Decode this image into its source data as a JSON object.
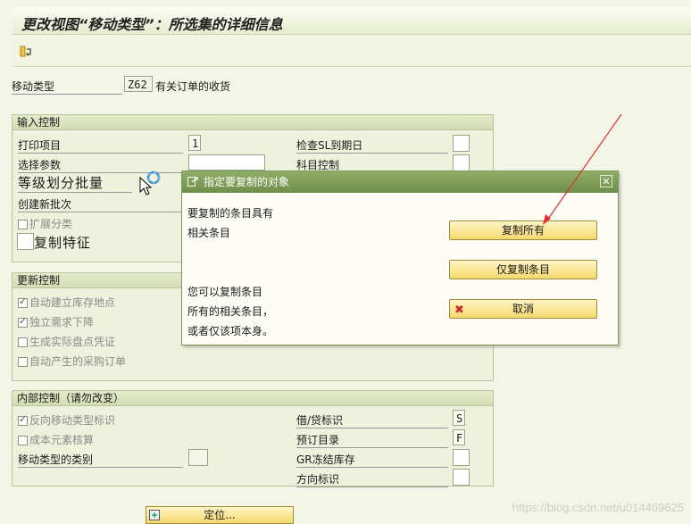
{
  "window": {
    "title": "更改视图“移动类型”：所选集的详细信息"
  },
  "movement": {
    "label": "移动类型",
    "value": "Z62",
    "description": "有关订单的收货"
  },
  "input_control": {
    "header": "输入控制",
    "print_item_label": "打印项目",
    "print_item_value": "1",
    "selection_param_label": "选择参数",
    "grade_batch_label": "等级划分批量",
    "create_batch_label": "创建新批次",
    "extend_class_label": "扩展分类",
    "copy_char_label": "复制特征",
    "check_sl_label": "检查SL到期日",
    "account_control_label": "科目控制"
  },
  "update_control": {
    "header": "更新控制",
    "auto_storage_label": "自动建立库存地点",
    "indep_req_label": "独立需求下降",
    "physical_inv_label": "生成实际盘点凭证",
    "auto_po_label": "自动产生的采购订单"
  },
  "internal_control": {
    "header": "内部控制（请勿改变）",
    "reverse_label": "反向移动类型标识",
    "cost_element_label": "成本元素核算",
    "mvt_category_label": "移动类型的类别",
    "debit_credit_label": "借/贷标识",
    "debit_credit_value": "S",
    "reservation_label": "预订目录",
    "reservation_value": "F",
    "gr_blocked_label": "GR冻结库存",
    "direction_label": "方向标识"
  },
  "dialog": {
    "title": "指定要复制的对象",
    "text_line1": "要复制的条目具有",
    "text_line2": "相关条目",
    "text_line3": "您可以复制条目",
    "text_line4": "所有的相关条目，",
    "text_line5": "或者仅该项本身。",
    "copy_all_label": "复制所有",
    "copy_only_label": "仅复制条目",
    "cancel_label": "取消"
  },
  "bottom": {
    "position_label": "定位..."
  },
  "watermark": "https://blog.csdn.net/u014469625",
  "colors": {
    "accent": "#6e8f4a",
    "button": "#f5d96e",
    "annotation_arrow": "#e03030"
  }
}
